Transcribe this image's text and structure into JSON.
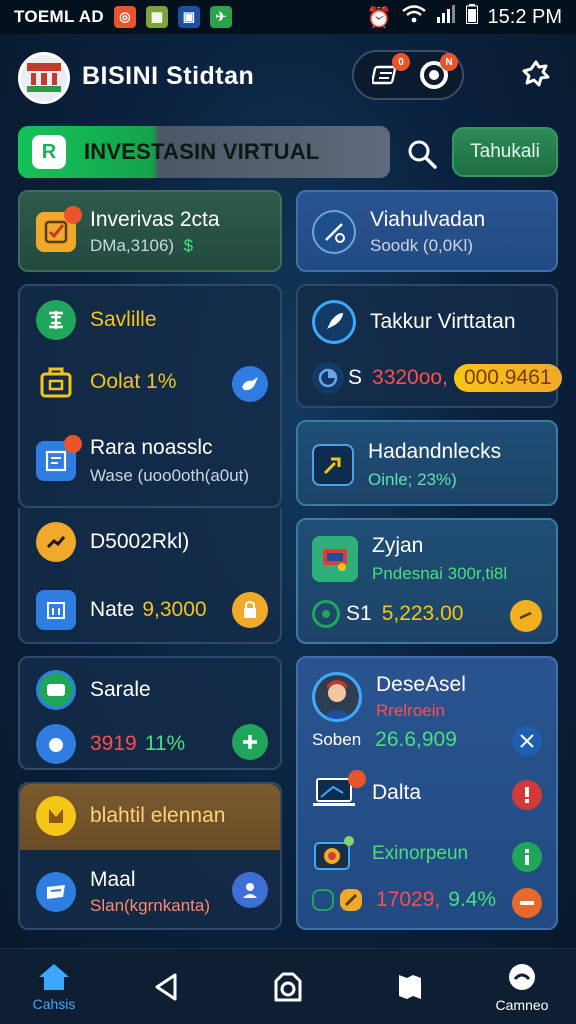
{
  "status_bar": {
    "left_text": "TOEML AD",
    "time": "15:2 PM"
  },
  "header": {
    "title": "BISINI Stidtan",
    "badge_a": "0",
    "badge_b": "N"
  },
  "banner": {
    "icon_letter": "R",
    "label": "INVESTASIN VIRTUAL"
  },
  "tahunan_button": "Tahukali",
  "cards": {
    "c1": {
      "title": "Inverivas 2cta",
      "subtitle": "DMa,3106)",
      "symbol": "$"
    },
    "c2": {
      "title": "Viahulvadan",
      "subtitle": "Soodk (0,0Kl)"
    },
    "c3": {
      "title": "Savlille",
      "value": "Oolat 1%"
    },
    "c4": {
      "title": "Takkur Virttatan",
      "symbol": "S",
      "value": "3320oo,",
      "pill": "000.9461"
    },
    "c5": {
      "title": "Rara noasslc",
      "subtitle": "Wase (uoo0oth(a0ut)"
    },
    "c6": {
      "title": "Hadandnlecks",
      "subtitle": "Oinle; 23%)"
    },
    "c7": {
      "title": "D5002Rkl)",
      "label": "Nate",
      "value": "9,3000"
    },
    "c8": {
      "title": "Zyjan",
      "subtitle": "Pndesnai 300r,ti8l",
      "symbol": "S1",
      "value": "5,223.00"
    },
    "c9": {
      "title": "Sarale",
      "value_red": "3919",
      "value_green": "11%"
    },
    "c10": {
      "title": "DeseAsel",
      "subtitle_red": "Rrelroein",
      "label": "Soben",
      "value": "26.6,909",
      "row2": "Dalta",
      "row3": "Exinorpeun",
      "row4_red": "17029,",
      "row4_green": "9.4%"
    },
    "c11": {
      "band": "blahtil elennan",
      "title": "Maal",
      "subtitle": "Slan(kgrnkanta)"
    }
  },
  "bottom_nav": {
    "home_label": "Cahsis",
    "profile_label": "Camneo"
  },
  "colors": {
    "accent_green": "#17c25a",
    "accent_yellow": "#f5c518",
    "accent_red": "#ff4d4d",
    "nav_active": "#3da8ff"
  }
}
